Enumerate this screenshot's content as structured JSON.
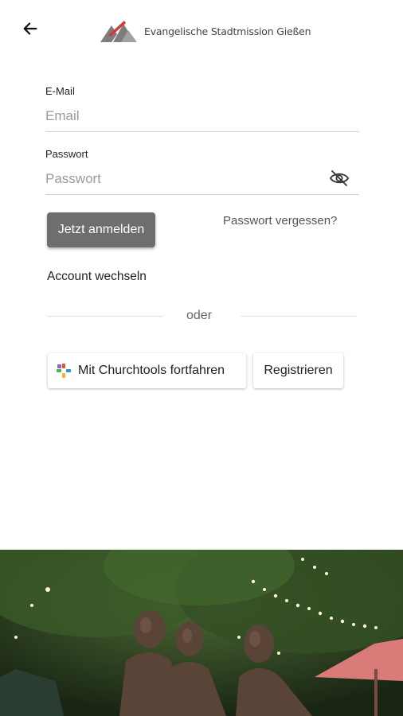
{
  "header": {
    "back_icon": "arrow-left-icon",
    "logo_icon": "stadtmission-logo-icon",
    "logo_text": "Evangelische Stadtmission Gießen"
  },
  "login": {
    "email": {
      "label": "E-Mail",
      "placeholder": "Email",
      "value": ""
    },
    "password": {
      "label": "Passwort",
      "placeholder": "Passwort",
      "value": "",
      "visibility_icon": "eye-off-icon"
    },
    "submit_label": "Jetzt anmelden",
    "forgot_label": "Passwort vergessen?",
    "switch_account_label": "Account wechseln",
    "divider_label": "oder",
    "churchtools_label": "Mit Churchtools fortfahren",
    "churchtools_icon": "churchtools-icon",
    "register_label": "Registrieren"
  },
  "footer_image": {
    "icon": "photo-bronze-statues-night",
    "colors": {
      "foliage": "#2f4a22",
      "lights": "#fff6c9",
      "umbrella": "#d97b78"
    }
  },
  "colors": {
    "primary_button": "#6e6e6e",
    "logo_red": "#d23a35",
    "logo_grey": "#7d7d7d"
  }
}
